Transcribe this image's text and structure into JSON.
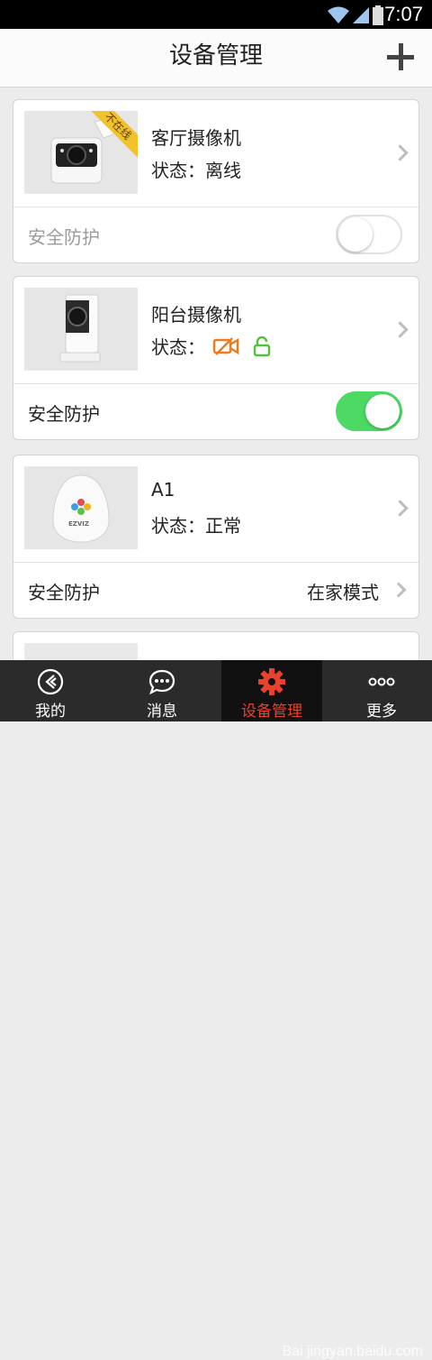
{
  "status_bar": {
    "time": "7:07"
  },
  "header": {
    "title": "设备管理"
  },
  "devices": [
    {
      "name": "客厅摄像机",
      "status": "状态：离线",
      "badge": "不在线",
      "protection_label": "安全防护",
      "protection_on": false
    },
    {
      "name": "阳台摄像机",
      "status": "状态：",
      "protection_label": "安全防护",
      "protection_on": true
    },
    {
      "name": "A1",
      "status": "状态：正常",
      "protection_label": "安全防护",
      "mode": "在家模式",
      "device_logo": "EZVIZ"
    }
  ],
  "tabs": [
    {
      "label": "我的"
    },
    {
      "label": "消息"
    },
    {
      "label": "设备管理"
    },
    {
      "label": "更多"
    }
  ],
  "watermark": "Bai jingyan.baidu.com",
  "colors": {
    "toggle_on": "#4cd964",
    "active_tab": "#e8412c",
    "badge": "#f3c22b",
    "icon_orange": "#f07a1a",
    "icon_green": "#55c13a"
  }
}
